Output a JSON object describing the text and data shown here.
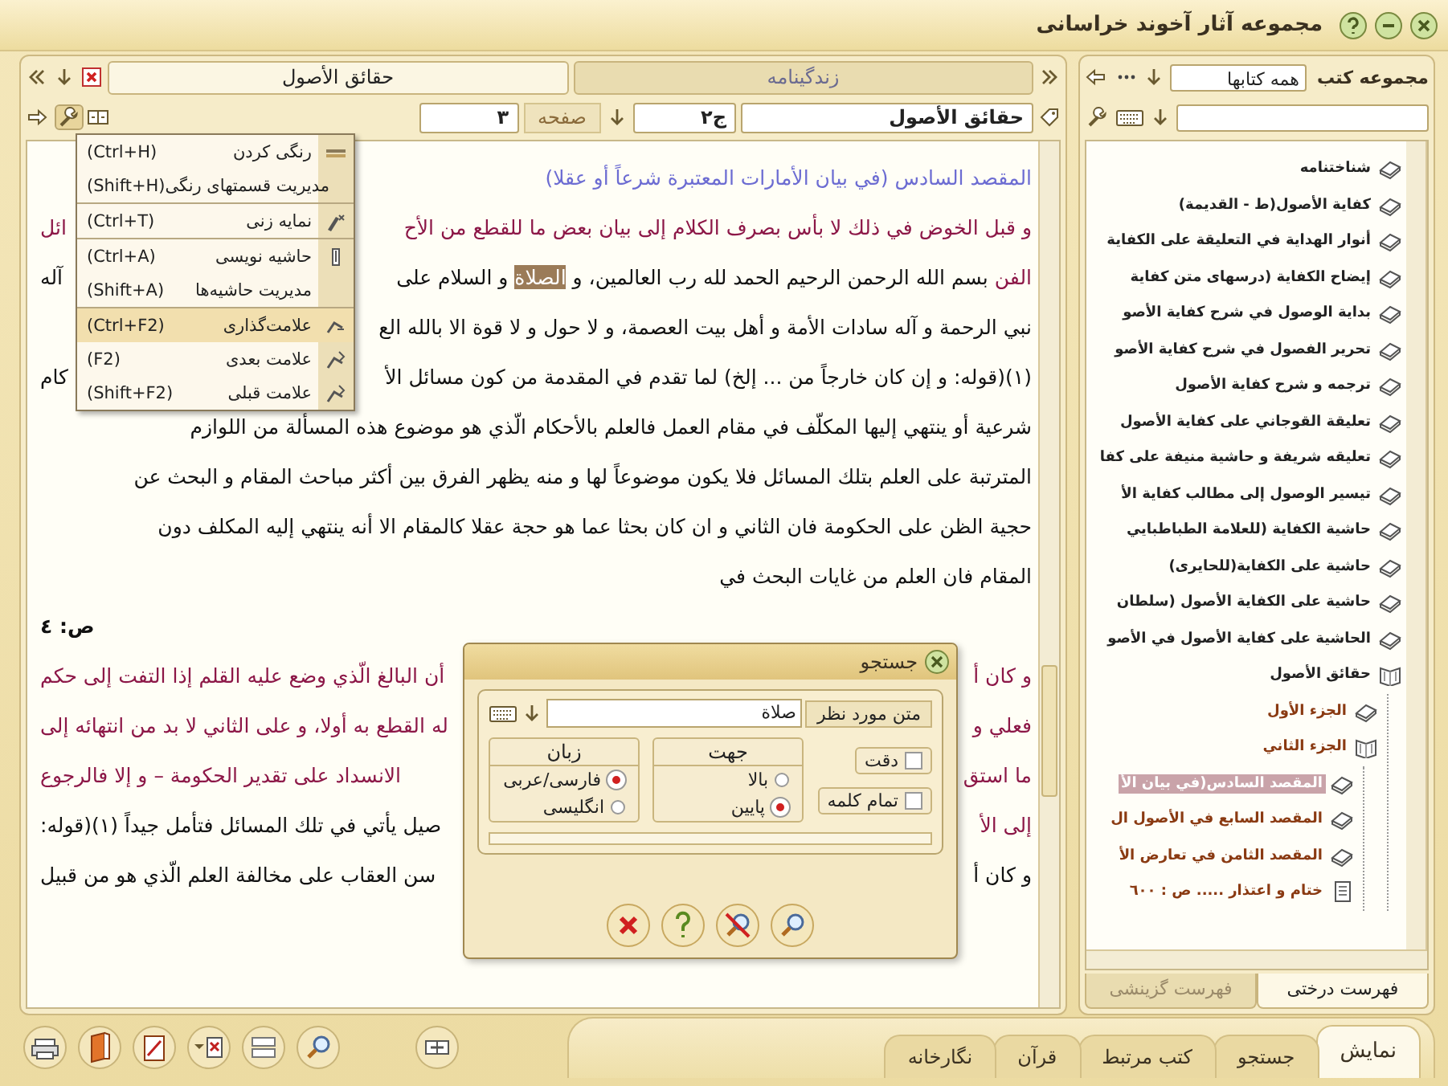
{
  "window": {
    "title": "مجموعه آثار آخوند خراسانی"
  },
  "document": {
    "tabs": [
      {
        "label": "زندگینامه",
        "selected": false
      },
      {
        "label": "حقائق الأصول",
        "selected": true
      }
    ],
    "toolbar": {
      "book": "حقائق الأصول",
      "volume": "ج٢",
      "page_label": "صفحه",
      "page": "٣"
    },
    "lines": [
      {
        "segments": [
          {
            "kind": "heading",
            "text": "المقصد السادس (في بيان الأمارات المعتبرة شرعاً أو عقلا)"
          }
        ]
      },
      {
        "segments": [
          {
            "kind": "quote",
            "text": "و قبل الخوض في ذلك لا بأس بصرف الكلام إلى بيان بعض ما للقطع من الأح"
          }
        ],
        "tail": {
          "kind": "quote",
          "text": "ائل"
        }
      },
      {
        "segments": [
          {
            "kind": "quote",
            "text": "الفن"
          },
          {
            "kind": "plain",
            "text": " بسم الله الرحمن الرحيم الحمد لله رب العالمين، و "
          },
          {
            "kind": "highlight",
            "text": "الصلاة"
          },
          {
            "kind": "plain",
            "text": " و السلام على"
          }
        ],
        "tail": {
          "kind": "plain",
          "text": "آله"
        }
      },
      {
        "segments": [
          {
            "kind": "plain",
            "text": "نبي الرحمة و آله سادات الأمة و أهل بيت العصمة، و لا حول و لا قوة الا بالله الع"
          }
        ]
      },
      {
        "segments": [
          {
            "kind": "plain",
            "text": "(١)(قوله: و إن كان خارجاً من ... إلخ) لما تقدم في المقدمة من كون مسائل الأ"
          }
        ],
        "tail": {
          "kind": "plain",
          "text": "كام"
        }
      },
      {
        "segments": [
          {
            "kind": "plain",
            "text": "شرعية أو ينتهي إليها المكلّف في مقام العمل فالعلم بالأحكام الّذي هو موضوع هذه المسألة من اللوازم"
          }
        ]
      },
      {
        "segments": [
          {
            "kind": "plain",
            "text": "المترتبة على العلم بتلك المسائل فلا يكون موضوعاً لها و منه يظهر الفرق بين أكثر مباحث المقام و البحث عن"
          }
        ]
      },
      {
        "segments": [
          {
            "kind": "plain",
            "text": "حجية الظن على الحكومة فان الثاني و ان كان بحثا عما هو حجة عقلا كالمقام الا أنه ينتهي إليه المكلف دون"
          }
        ]
      },
      {
        "segments": [
          {
            "kind": "plain",
            "text": "المقام فان العلم من غايات البحث في"
          }
        ]
      },
      {
        "tail": {
          "kind": "pagenum",
          "text": "ص: ٤"
        }
      },
      {
        "segments": [
          {
            "kind": "quote",
            "text": "و كان أ"
          }
        ],
        "tail": {
          "kind": "quote",
          "text": "أن البالغ الّذي وضع عليه القلم إذا التفت إلى حكم"
        }
      },
      {
        "segments": [
          {
            "kind": "quote",
            "text": "فعلي و"
          }
        ],
        "tail": {
          "kind": "quote",
          "text": "له القطع به أولا، و على الثاني لا بد من انتهائه إلى"
        }
      },
      {
        "segments": [
          {
            "kind": "quote",
            "text": "ما استق"
          }
        ],
        "tail": {
          "kind": "quote",
          "text": "الانسداد على تقدير الحكومة – و إلا فالرجوع"
        }
      },
      {
        "segments": [
          {
            "kind": "quote",
            "text": "إلى الأ"
          }
        ],
        "tail": {
          "kind": "plain",
          "text": "صيل يأتي في تلك المسائل فتأمل جيداً (١)(قوله:"
        }
      },
      {
        "segments": [
          {
            "kind": "plain",
            "text": "و كان أ"
          }
        ],
        "tail": {
          "kind": "plain",
          "text": "سن العقاب على مخالفة العلم الّذي هو من قبيل"
        }
      }
    ]
  },
  "context_menu": {
    "groups": [
      [
        {
          "kind": "color",
          "label": "رنگی کردن",
          "shortcut": "(Ctrl+H)",
          "selected": false
        },
        {
          "kind": "color-manage",
          "label": "مدیریت قسمتهای رنگی",
          "shortcut": "(Shift+H)",
          "selected": false
        }
      ],
      [
        {
          "kind": "index",
          "label": "نمایه زنی",
          "shortcut": "(Ctrl+T)",
          "selected": false
        }
      ],
      [
        {
          "kind": "note",
          "label": "حاشیه نویسی",
          "shortcut": "(Ctrl+A)",
          "selected": false
        },
        {
          "kind": "note-manage",
          "label": "مدیریت حاشیه‌ها",
          "shortcut": "(Shift+A)",
          "selected": false
        }
      ],
      [
        {
          "kind": "bookmark",
          "label": "علامت‌گذاری",
          "shortcut": "(Ctrl+F2)",
          "selected": true
        },
        {
          "kind": "bookmark-next",
          "label": "علامت بعدی",
          "shortcut": "(F2)",
          "selected": false
        },
        {
          "kind": "bookmark-prev",
          "label": "علامت قبلی",
          "shortcut": "(Shift+F2)",
          "selected": false
        }
      ]
    ]
  },
  "search_dialog": {
    "title": "جستجو",
    "field_label": "متن مورد نظر",
    "query": "صلاة",
    "options": [
      {
        "label": "دقت",
        "checked": false
      },
      {
        "label": "تمام کلمه",
        "checked": false
      }
    ],
    "direction": {
      "title": "جهت",
      "options": [
        {
          "label": "بالا",
          "selected": false
        },
        {
          "label": "پایین",
          "selected": true
        }
      ]
    },
    "language": {
      "title": "زبان",
      "options": [
        {
          "label": "فارسی/عربی",
          "selected": true
        },
        {
          "label": "انگلیسی",
          "selected": false
        }
      ]
    },
    "progress": {
      "level": 0
    },
    "buttons": [
      {
        "kind": "search"
      },
      {
        "kind": "clear"
      },
      {
        "kind": "help"
      },
      {
        "kind": "cancel"
      }
    ]
  },
  "sidebar": {
    "label": "مجموعه کتب",
    "filter": "همه کتابها",
    "tree": [
      {
        "label": "شناختنامه",
        "kind": "book",
        "expanded": false,
        "selected": false
      },
      {
        "label": "كفاية الأصول(ط - القديمة)",
        "kind": "book",
        "expanded": false,
        "selected": false
      },
      {
        "label": "أنوار الهداية في التعليقة على الكفاية",
        "kind": "book",
        "expanded": false,
        "selected": false
      },
      {
        "label": "إيضاح الكفاية (درسهای متن كفاية",
        "kind": "book",
        "expanded": false,
        "selected": false
      },
      {
        "label": "بداية الوصول في شرح كفاية الأصو",
        "kind": "book",
        "expanded": false,
        "selected": false
      },
      {
        "label": "تحرير الفصول في شرح كفاية الأصو",
        "kind": "book",
        "expanded": false,
        "selected": false
      },
      {
        "label": "ترجمه و شرح كفاية الأصول",
        "kind": "book",
        "expanded": false,
        "selected": false
      },
      {
        "label": "تعليقة القوجاني على كفاية الأصول",
        "kind": "book",
        "expanded": false,
        "selected": false
      },
      {
        "label": "تعليقه شريفة و حاشية منيفة على كفا",
        "kind": "book",
        "expanded": false,
        "selected": false
      },
      {
        "label": "تيسير الوصول إلى مطالب كفاية الأ",
        "kind": "book",
        "expanded": false,
        "selected": false
      },
      {
        "label": "حاشية الكفاية (للعلامة الطباطبايي",
        "kind": "book",
        "expanded": false,
        "selected": false
      },
      {
        "label": "حاشية على الكفاية(للحايرى)",
        "kind": "book",
        "expanded": false,
        "selected": false
      },
      {
        "label": "حاشية على الكفاية الأصول (سلطان",
        "kind": "book",
        "expanded": false,
        "selected": false
      },
      {
        "label": "الحاشية على كفاية الأصول في الأصو",
        "kind": "book",
        "expanded": false,
        "selected": false
      },
      {
        "label": "حقائق الأصول",
        "kind": "book",
        "expanded": true,
        "selected": false,
        "children": [
          {
            "label": "الجزء الأول",
            "kind": "book",
            "expanded": false,
            "selected": false
          },
          {
            "label": "الجزء الثاني",
            "kind": "book",
            "expanded": true,
            "selected": false,
            "children": [
              {
                "label": "المقصد السادس(في بيان الأ",
                "kind": "book",
                "expanded": false,
                "selected": true
              },
              {
                "label": "المقصد السابع في الأصول ال",
                "kind": "book",
                "expanded": false,
                "selected": false
              },
              {
                "label": "المقصد الثامن في تعارض الأ",
                "kind": "book",
                "expanded": false,
                "selected": false
              },
              {
                "label": "ختام و اعتذار ..... ص : ٦٠٠",
                "kind": "page",
                "selected": false
              }
            ]
          }
        ]
      }
    ],
    "tabs": [
      {
        "label": "فهرست درختی",
        "selected": true
      },
      {
        "label": "فهرست گزینشی",
        "selected": false
      }
    ]
  },
  "bottom_bar": {
    "tools": [
      {
        "kind": "print"
      },
      {
        "kind": "book"
      },
      {
        "kind": "note"
      },
      {
        "kind": "bookmark"
      },
      {
        "kind": "layout"
      },
      {
        "kind": "search"
      },
      {
        "kind": "link"
      }
    ],
    "tabs": [
      {
        "label": "نمایش",
        "selected": true
      },
      {
        "label": "جستجو",
        "selected": false
      },
      {
        "label": "کتب مرتبط",
        "selected": false
      },
      {
        "label": "قرآن",
        "selected": false
      },
      {
        "label": "نگارخانه",
        "selected": false
      }
    ]
  }
}
